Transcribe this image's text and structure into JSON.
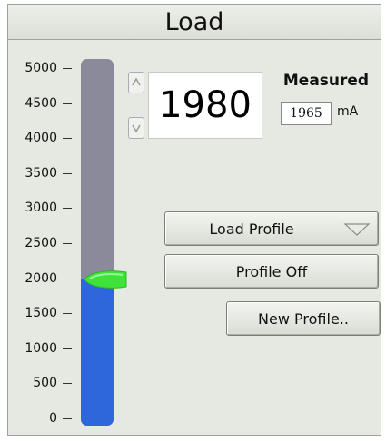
{
  "panel": {
    "title": "Load"
  },
  "scale": {
    "labels": [
      "5000",
      "4500",
      "4000",
      "3500",
      "3000",
      "2500",
      "2000",
      "1500",
      "1000",
      "500",
      "0"
    ],
    "min": 0,
    "max": 5000
  },
  "slider": {
    "setpoint": 1980,
    "fill_color": "#2e66dc",
    "track_color": "#8a8a9a",
    "thumb_color": "#3fe23a"
  },
  "setpoint_field": {
    "value": "1980"
  },
  "measured": {
    "label": "Measured",
    "value": "1965",
    "unit": "mA"
  },
  "buttons": {
    "load_profile": "Load Profile",
    "profile_off": "Profile Off",
    "new_profile": "New Profile.."
  }
}
